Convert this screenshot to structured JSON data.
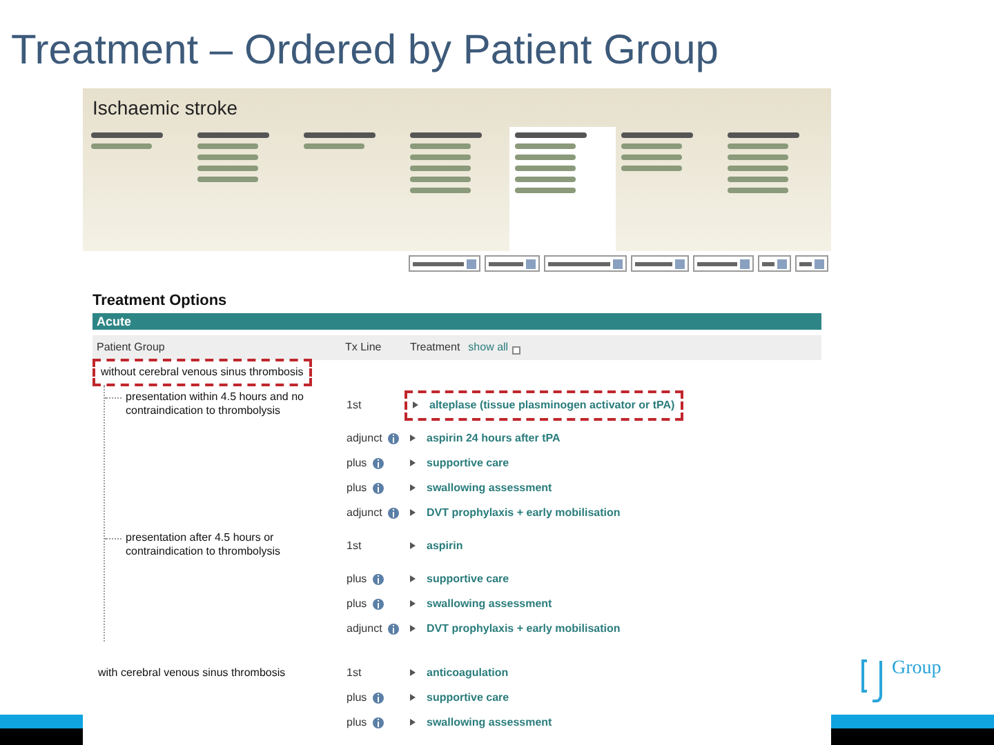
{
  "slide_title": "Treatment – Ordered by Patient Group",
  "app": {
    "title": "Ischaemic stroke",
    "section_title": "Treatment Options",
    "phase": "Acute",
    "columns": [
      "Patient Group",
      "Tx Line",
      "Treatment"
    ],
    "show_all": {
      "label": "show all",
      "checked": false
    },
    "groups": [
      {
        "label": "without cerebral venous sinus thrombosis",
        "highlighted": true,
        "children": [
          {
            "label": "presentation within 4.5 hours and no contraindication to thrombolysis",
            "rows": [
              {
                "tx_line": "1st",
                "info": false,
                "treatment": "alteplase (tissue plasminogen activator or tPA)",
                "highlighted": true
              },
              {
                "tx_line": "adjunct",
                "info": true,
                "treatment": "aspirin 24 hours after tPA",
                "highlighted": false
              },
              {
                "tx_line": "plus",
                "info": true,
                "treatment": "supportive care",
                "highlighted": false
              },
              {
                "tx_line": "plus",
                "info": true,
                "treatment": "swallowing assessment",
                "highlighted": false
              },
              {
                "tx_line": "adjunct",
                "info": true,
                "treatment": "DVT prophylaxis + early mobilisation",
                "highlighted": false
              }
            ]
          },
          {
            "label": "presentation after 4.5 hours or contraindication to thrombolysis",
            "rows": [
              {
                "tx_line": "1st",
                "info": false,
                "treatment": "aspirin",
                "highlighted": false
              },
              {
                "tx_line": "plus",
                "info": true,
                "treatment": "supportive care",
                "highlighted": false
              },
              {
                "tx_line": "plus",
                "info": true,
                "treatment": "swallowing assessment",
                "highlighted": false
              },
              {
                "tx_line": "adjunct",
                "info": true,
                "treatment": "DVT prophylaxis + early mobilisation",
                "highlighted": false
              }
            ]
          }
        ]
      },
      {
        "label": "with cerebral venous sinus thrombosis",
        "highlighted": false,
        "rows": [
          {
            "tx_line": "1st",
            "info": false,
            "treatment": "anticoagulation",
            "highlighted": false
          },
          {
            "tx_line": "plus",
            "info": true,
            "treatment": "supportive care",
            "highlighted": false
          },
          {
            "tx_line": "plus",
            "info": true,
            "treatment": "swallowing assessment",
            "highlighted": false
          }
        ]
      }
    ]
  },
  "logo": {
    "text": "Group"
  }
}
